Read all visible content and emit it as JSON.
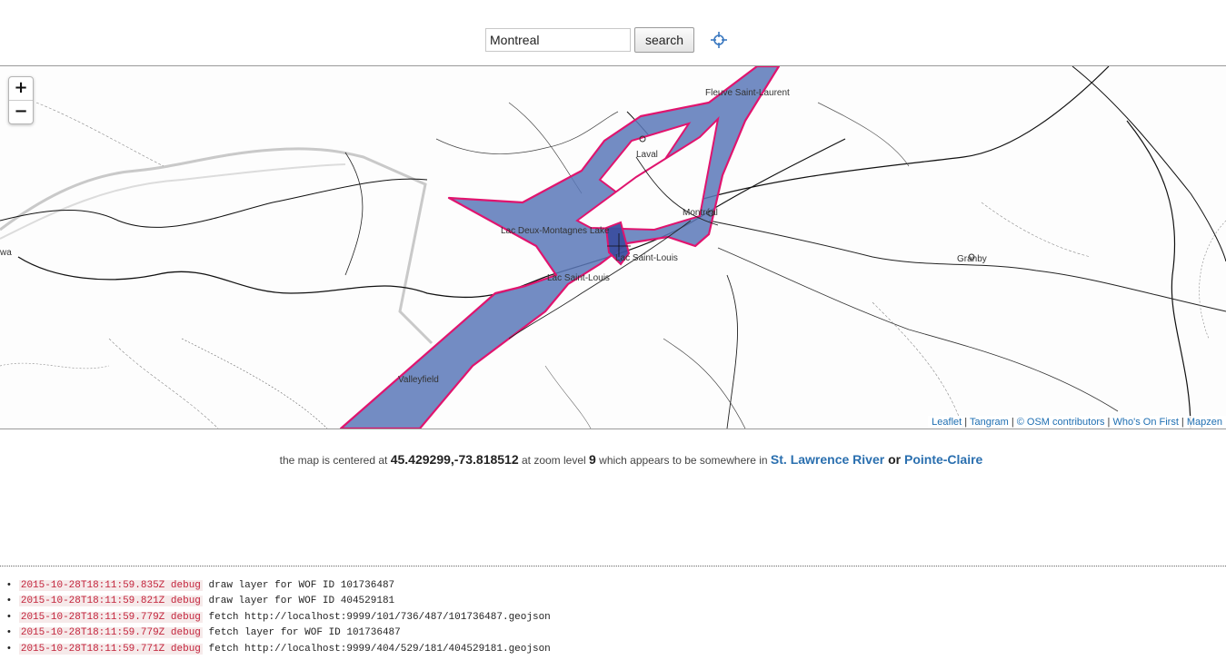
{
  "search": {
    "value": "Montreal",
    "button_label": "search",
    "locate_icon": "crosshair-icon"
  },
  "map": {
    "zoom_in_label": "+",
    "zoom_out_label": "−",
    "labels": {
      "fleuve": "Fleuve Saint-Laurent",
      "laval": "Laval",
      "montreal": "Montréal",
      "lac_deux": "Lac Deux-Montagnes Lake",
      "lac_st_louis_1": "Lac Saint-Louis",
      "lac_st_louis_2": "Lac Saint-Louis",
      "granby": "Granby",
      "valleyfield": "Valleyfield",
      "ottawa": "wa"
    },
    "attribution": {
      "leaflet": "Leaflet",
      "tangram": "Tangram",
      "osm": "© OSM contributors",
      "wof": "Who's On First",
      "mapzen": "Mapzen",
      "sep": " | "
    },
    "colors": {
      "polygon_fill": "#5a78b8",
      "polygon_stroke": "#e0146e",
      "selected_fill": "#3b4fa0"
    }
  },
  "status": {
    "prefix": "the map is centered at ",
    "coords": "45.429299,-73.818512",
    "mid1": " at zoom level ",
    "zoom": "9",
    "mid2": " which appears to be somewhere in ",
    "place1": "St. Lawrence River",
    "or": " or ",
    "place2": "Pointe-Claire"
  },
  "log": [
    {
      "meta": "2015-10-28T18:11:59.835Z debug",
      "message": "draw layer for WOF ID 101736487"
    },
    {
      "meta": "2015-10-28T18:11:59.821Z debug",
      "message": "draw layer for WOF ID 404529181"
    },
    {
      "meta": "2015-10-28T18:11:59.779Z debug",
      "message": "fetch http://localhost:9999/101/736/487/101736487.geojson"
    },
    {
      "meta": "2015-10-28T18:11:59.779Z debug",
      "message": "fetch layer for WOF ID 101736487"
    },
    {
      "meta": "2015-10-28T18:11:59.771Z debug",
      "message": "fetch http://localhost:9999/404/529/181/404529181.geojson"
    }
  ]
}
